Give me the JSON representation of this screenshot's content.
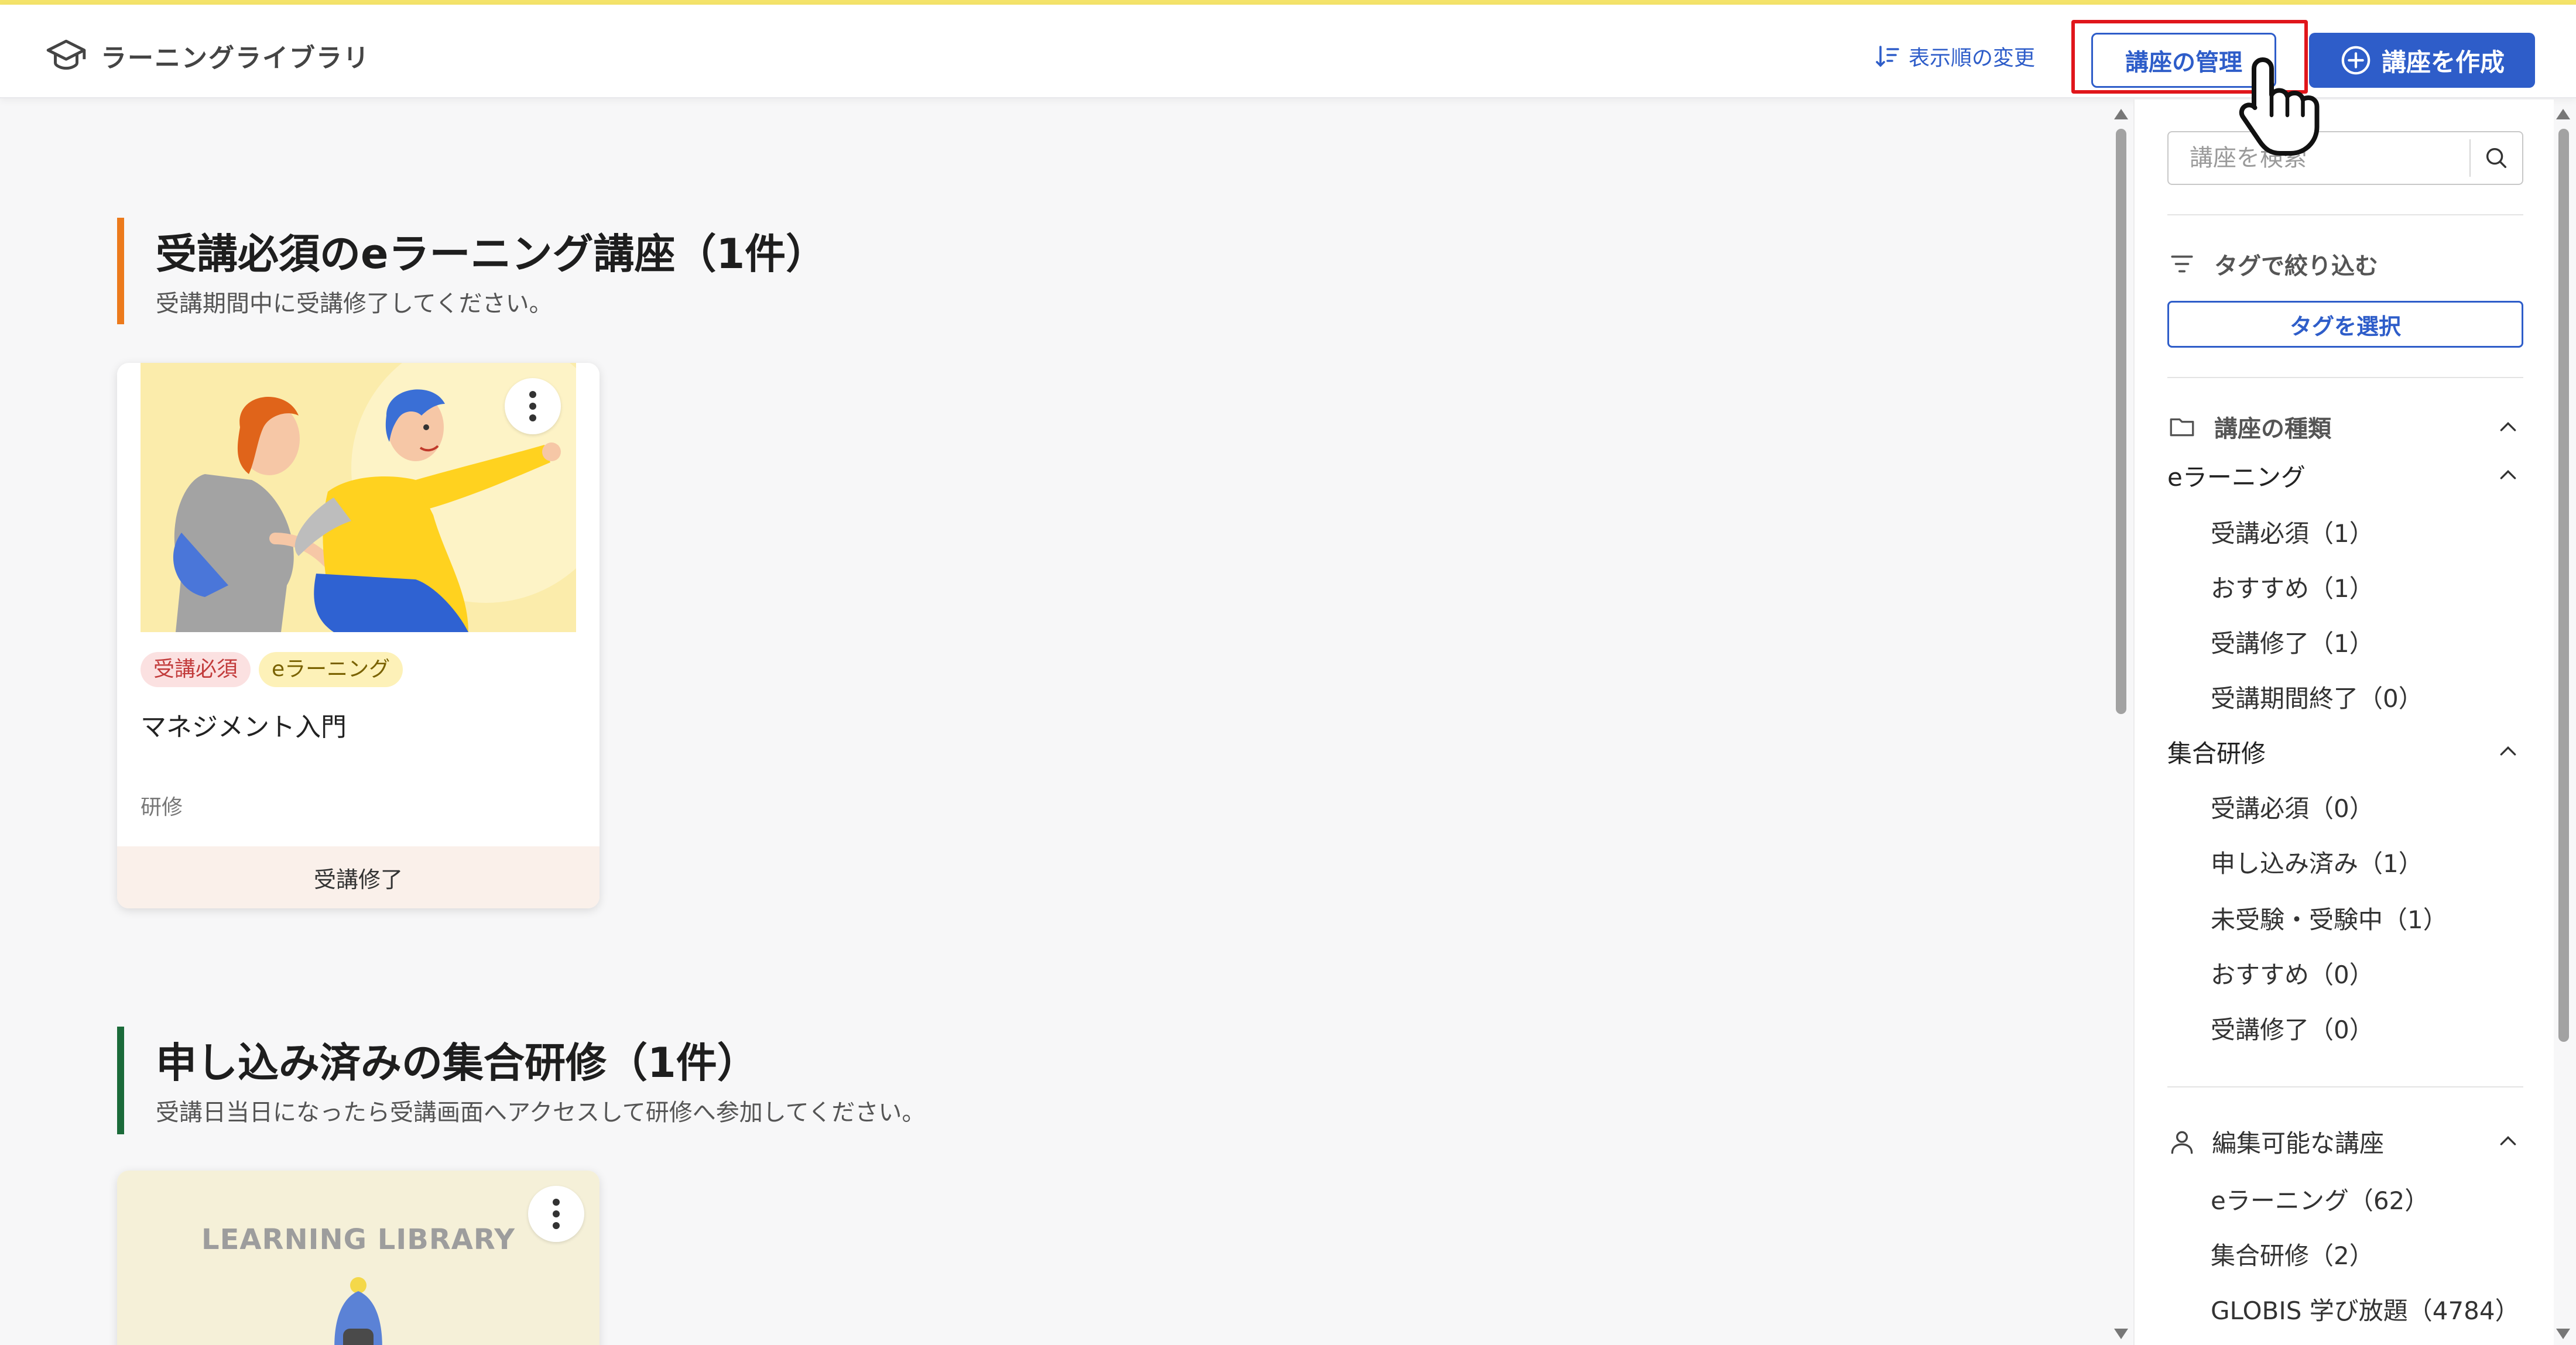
{
  "header": {
    "brand_title": "ラーニングライブラリ",
    "sort_label": "表示順の変更",
    "manage_label": "講座の管理",
    "create_label": "講座を作成"
  },
  "sections": [
    {
      "title": "受講必須のeラーニング講座（1件）",
      "subtitle": "受講期間中に受講修了してください。",
      "accent_color": "#ec7a1c",
      "card": {
        "tags": [
          "受講必須",
          "eラーニング"
        ],
        "title": "マネジメント入門",
        "category": "研修",
        "footer": "受講修了"
      }
    },
    {
      "title": "申し込み済みの集合研修（1件）",
      "subtitle": "受講日当日になったら受講画面へアクセスして研修へ参加してください。",
      "accent_color": "#1b6b3a",
      "card": {
        "image_text": "LEARNING LIBRARY"
      }
    }
  ],
  "sidebar": {
    "search_placeholder": "講座を検索",
    "tag_filter_label": "タグで絞り込む",
    "tag_select_label": "タグを選択",
    "course_type_label": "講座の種類",
    "elearning": {
      "label": "eラーニング",
      "items": [
        "受講必須（1）",
        "おすすめ（1）",
        "受講修了（1）",
        "受講期間終了（0）"
      ]
    },
    "group_training": {
      "label": "集合研修",
      "items": [
        "受講必須（0）",
        "申し込み済み（1）",
        "未受験・受験中（1）",
        "おすすめ（0）",
        "受講修了（0）"
      ]
    },
    "editable": {
      "label": "編集可能な講座",
      "items": [
        "eラーニング（62）",
        "集合研修（2）",
        "GLOBIS 学び放題（4784）"
      ]
    }
  },
  "colors": {
    "primary": "#2e5dc9",
    "highlight": "#e0161b",
    "top_accent": "#f4e36a"
  },
  "icons": {
    "brand": "graduation-cap-icon",
    "sort": "sort-icon",
    "create": "plus-circle-icon",
    "search": "search-icon",
    "filter": "filter-icon",
    "folder": "folder-icon",
    "user": "user-icon",
    "chevron": "chevron-up-icon",
    "cursor": "hand-cursor-icon"
  }
}
